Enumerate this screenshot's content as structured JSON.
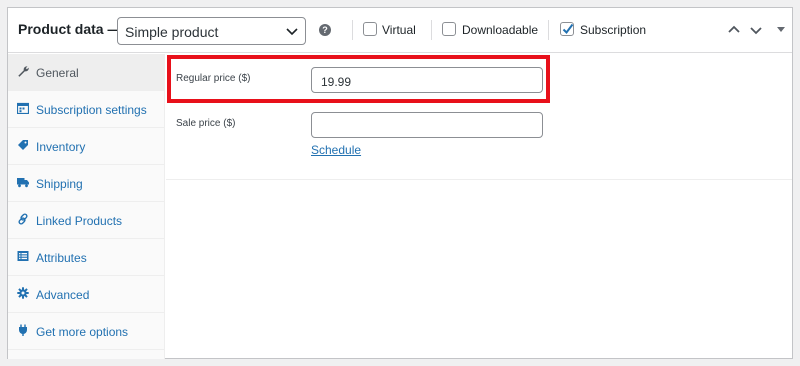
{
  "header": {
    "title": "Product data —",
    "product_type": "Simple product",
    "options": [
      {
        "label": "Virtual",
        "checked": false
      },
      {
        "label": "Downloadable",
        "checked": false
      },
      {
        "label": "Subscription",
        "checked": true
      }
    ]
  },
  "sidebar": {
    "items": [
      {
        "label": "General",
        "icon": "wrench-icon",
        "active": true
      },
      {
        "label": "Subscription settings",
        "icon": "calendar-icon",
        "active": false
      },
      {
        "label": "Inventory",
        "icon": "tag-icon",
        "active": false
      },
      {
        "label": "Shipping",
        "icon": "truck-icon",
        "active": false
      },
      {
        "label": "Linked Products",
        "icon": "link-icon",
        "active": false
      },
      {
        "label": "Attributes",
        "icon": "list-icon",
        "active": false
      },
      {
        "label": "Advanced",
        "icon": "gear-icon",
        "active": false
      },
      {
        "label": "Get more options",
        "icon": "plugin-icon",
        "active": false
      }
    ]
  },
  "general": {
    "regular_price_label": "Regular price ($)",
    "regular_price_value": "19.99",
    "sale_price_label": "Sale price ($)",
    "sale_price_value": "",
    "schedule_link": "Schedule"
  },
  "colors": {
    "accent": "#2271b1",
    "highlight": "#e8101a"
  }
}
